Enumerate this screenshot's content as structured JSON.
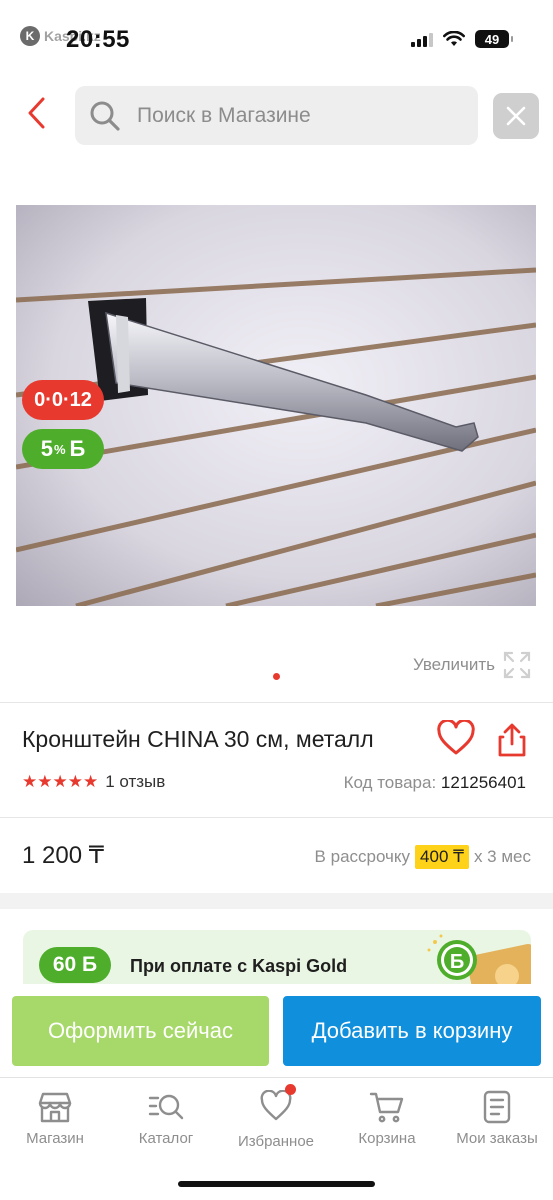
{
  "status_bar": {
    "back_app": "Kaspi.kz",
    "time": "20:55",
    "battery": "49"
  },
  "search": {
    "placeholder": "Поиск в Магазине",
    "value": ""
  },
  "product": {
    "badges": {
      "installment": "0·0·12",
      "bonus_percent": "5",
      "bonus_suffix": "%",
      "bonus_currency": "Б"
    },
    "zoom_label": "Увеличить",
    "title": "Кронштейн CHINA 30 см, металл",
    "rating_stars": "★★★★★",
    "reviews": "1 отзыв",
    "sku_label": "Код товара:",
    "sku_value": "121256401",
    "price": "1 200 ₸",
    "installment": {
      "prefix": "В рассрочку",
      "amount": "400 ₸",
      "suffix": "x 3 мес"
    }
  },
  "promo": {
    "badge": "60 Б",
    "text": "При оплате с Kaspi Gold"
  },
  "actions": {
    "buy_now": "Оформить сейчас",
    "add_to_cart": "Добавить в корзину"
  },
  "tabbar": {
    "items": [
      {
        "label": "Магазин",
        "icon": "shop-icon"
      },
      {
        "label": "Каталог",
        "icon": "catalog-search-icon"
      },
      {
        "label": "Избранное",
        "icon": "heart-icon"
      },
      {
        "label": "Корзина",
        "icon": "cart-icon"
      },
      {
        "label": "Мои заказы",
        "icon": "orders-icon"
      }
    ]
  },
  "colors": {
    "accent_red": "#e8392f",
    "bonus_green": "#4fad2c",
    "buy_green": "#a7d96a",
    "cart_blue": "#0f8fdc",
    "installment_yellow": "#ffd21a"
  }
}
